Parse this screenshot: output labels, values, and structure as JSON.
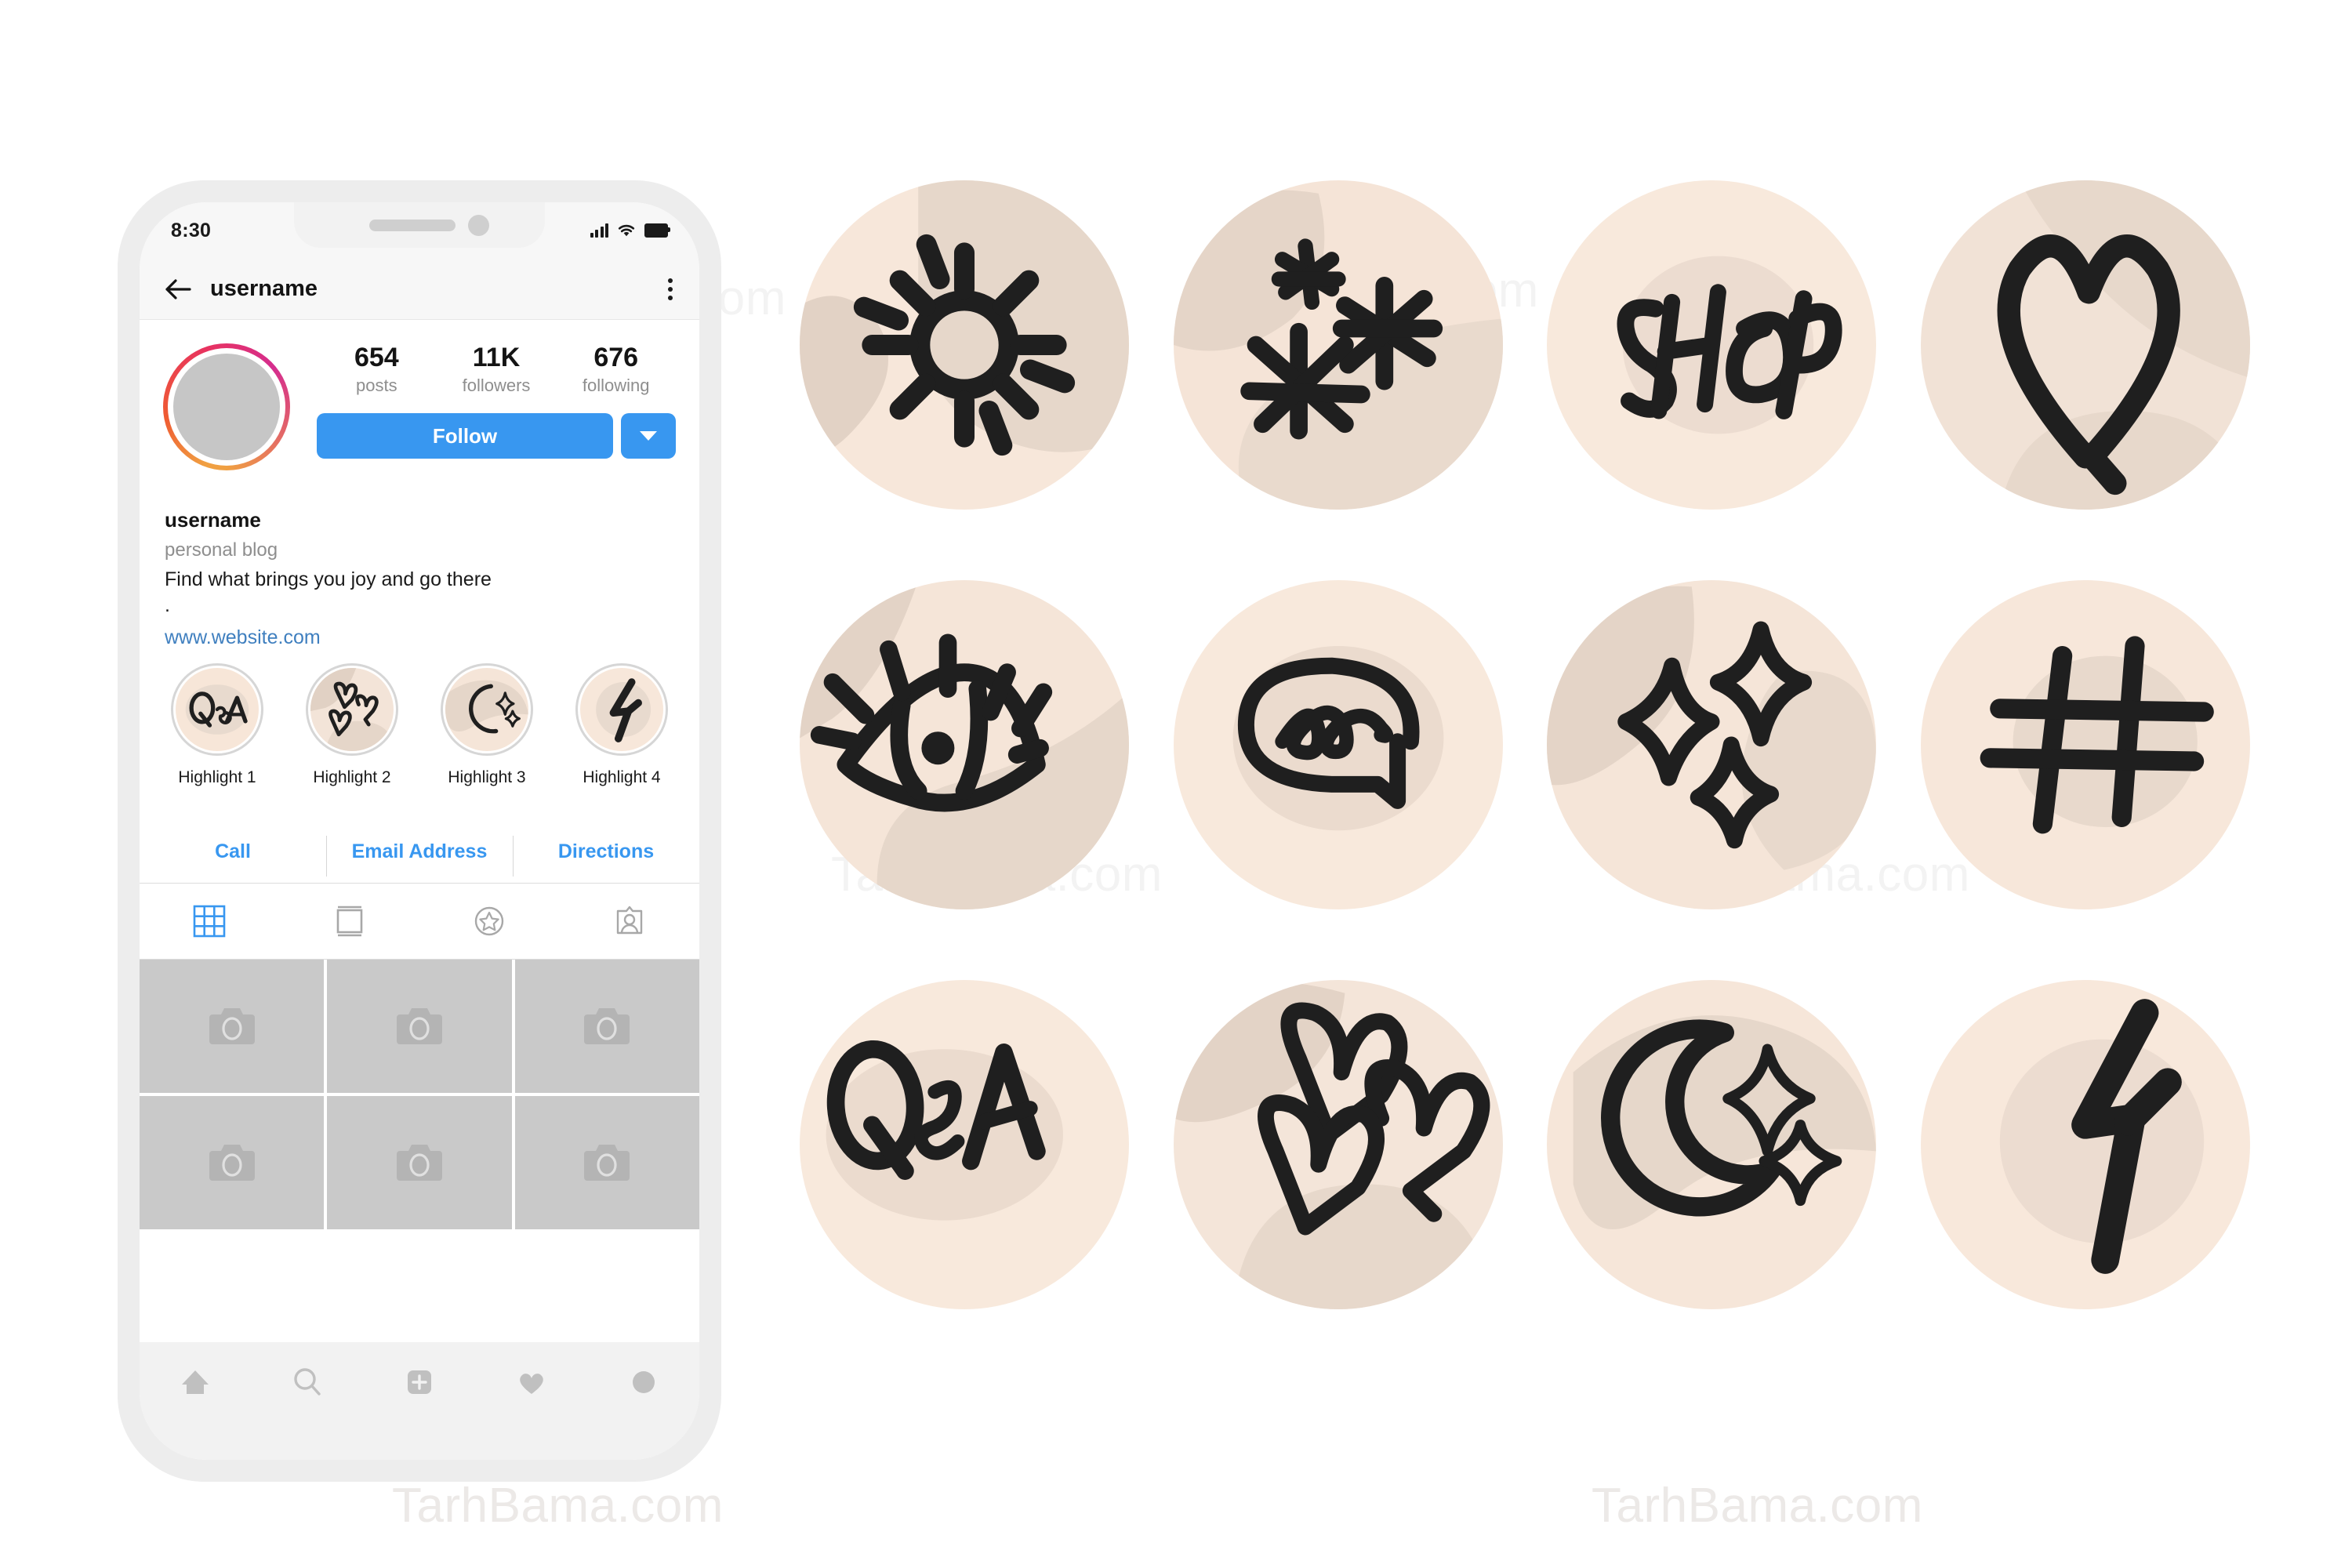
{
  "watermark": {
    "text": "TarhBama.com"
  },
  "phone": {
    "status": {
      "time": "8:30",
      "signal_icon": "signal-bars-icon",
      "wifi_icon": "wifi-icon",
      "battery_icon": "battery-icon"
    },
    "header": {
      "back_icon": "back-arrow-icon",
      "title": "username",
      "menu_icon": "more-options-icon"
    },
    "profile": {
      "avatar_icon": "avatar",
      "stats": [
        {
          "value": "654",
          "label": "posts"
        },
        {
          "value": "11K",
          "label": "followers"
        },
        {
          "value": "676",
          "label": "following"
        }
      ],
      "follow_label": "Follow",
      "more_icon": "chevron-down-icon"
    },
    "bio": {
      "name": "username",
      "category": "personal blog",
      "text": "Find what brings you joy and go there",
      "dot": ".",
      "link": "www.website.com"
    },
    "highlights": [
      {
        "label": "Highlight 1",
        "icon": "qanda-icon"
      },
      {
        "label": "Highlight 2",
        "icon": "hearts-icon"
      },
      {
        "label": "Highlight 3",
        "icon": "moon-stars-icon"
      },
      {
        "label": "Highlight 4",
        "icon": "lightning-bolt-icon"
      }
    ],
    "contact_buttons": [
      {
        "label": "Call",
        "icon": "call-button"
      },
      {
        "label": "Email Address",
        "icon": "email-button"
      },
      {
        "label": "Directions",
        "icon": "directions-button"
      }
    ],
    "tabs": [
      {
        "icon": "grid-tab-icon",
        "active": true
      },
      {
        "icon": "reels-tab-icon",
        "active": false
      },
      {
        "icon": "star-tab-icon",
        "active": false
      },
      {
        "icon": "tagged-tab-icon",
        "active": false
      }
    ],
    "grid_cell_icon": "camera-placeholder-icon",
    "grid_cell_count": 6,
    "bottom_nav": [
      {
        "icon": "home-icon"
      },
      {
        "icon": "search-icon"
      },
      {
        "icon": "add-post-icon"
      },
      {
        "icon": "heart-activity-icon"
      },
      {
        "icon": "profile-avatar-icon"
      }
    ]
  },
  "covers": {
    "rows": [
      [
        {
          "name": "sun-cover",
          "icon": "sun-icon"
        },
        {
          "name": "asterisks-cover",
          "icon": "asterisks-icon"
        },
        {
          "name": "shop-cover",
          "icon": "shop-text-icon",
          "text": "SHOP"
        },
        {
          "name": "heart-cover",
          "icon": "heart-outline-icon"
        }
      ],
      [
        {
          "name": "eye-cover",
          "icon": "eye-icon"
        },
        {
          "name": "speech-bubble-cover",
          "icon": "speech-bubble-icon"
        },
        {
          "name": "sparkles-cover",
          "icon": "sparkles-icon"
        },
        {
          "name": "hashtag-cover",
          "icon": "hashtag-icon"
        }
      ],
      [
        {
          "name": "qanda-cover",
          "icon": "qanda-icon",
          "text": "Q&A"
        },
        {
          "name": "hearts-cover",
          "icon": "hearts-icon"
        },
        {
          "name": "moon-cover",
          "icon": "moon-stars-icon"
        },
        {
          "name": "bolt-cover",
          "icon": "lightning-bolt-icon"
        }
      ]
    ]
  },
  "colors": {
    "cover_base": "#f7e6d8",
    "cover_blob": "#e3d3c6",
    "cover_blob_alt": "#ecddd0",
    "ink": "#1f1f1f",
    "instagram_blue": "#3897f0",
    "link_blue": "#3f7fbf",
    "muted_gray": "#8e8e8e",
    "placeholder_gray": "#c9c9c9"
  }
}
